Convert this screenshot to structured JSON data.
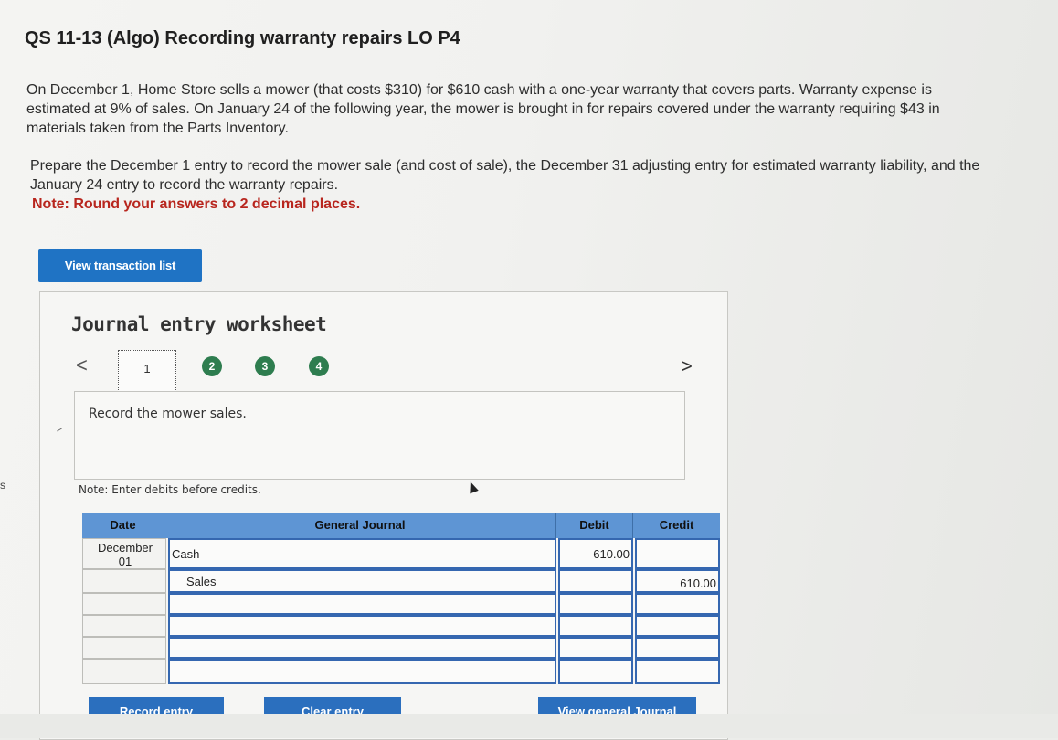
{
  "title": "QS 11-13 (Algo) Recording warranty repairs LO P4",
  "paragraph1": "On December 1, Home Store sells a mower (that costs $310) for $610 cash with a one-year warranty that covers parts. Warranty expense is estimated at 9% of sales. On January 24 of the following year, the mower is brought in for repairs covered under the warranty requiring $43 in materials taken from the Parts Inventory.",
  "paragraph2": "Prepare the December 1 entry to record the mower sale (and cost of sale), the December 31 adjusting entry for estimated warranty liability, and the January 24 entry to record the warranty repairs.",
  "note": "Note: Round your answers to 2 decimal places.",
  "left_edge_text": "s",
  "view_button_label": "View transaction list",
  "worksheet": {
    "title": "Journal entry worksheet",
    "prev_glyph": "<",
    "next_glyph": ">",
    "steps": [
      "1",
      "2",
      "3",
      "4"
    ],
    "active_step": "1",
    "instruction": "Record the mower sales.",
    "debit_note": "Note: Enter debits before credits."
  },
  "journal": {
    "headers": {
      "date": "Date",
      "general_journal": "General Journal",
      "debit": "Debit",
      "credit": "Credit"
    },
    "rows": [
      {
        "date": "December\n01",
        "account": "Cash",
        "debit": "610.00",
        "credit": ""
      },
      {
        "date": "",
        "account": "Sales",
        "debit": "",
        "credit": "610.00"
      },
      {
        "date": "",
        "account": "",
        "debit": "",
        "credit": ""
      },
      {
        "date": "",
        "account": "",
        "debit": "",
        "credit": ""
      },
      {
        "date": "",
        "account": "",
        "debit": "",
        "credit": ""
      },
      {
        "date": "",
        "account": "",
        "debit": "",
        "credit": ""
      }
    ]
  },
  "bottom_buttons": [
    "Record entry",
    "Clear entry",
    "View general Journal"
  ],
  "colors": {
    "primary_button": "#1f73c4",
    "table_header": "#5e95d4",
    "input_border": "#3567b0",
    "step_complete": "#2e7d4f",
    "note_red": "#b8261e"
  }
}
